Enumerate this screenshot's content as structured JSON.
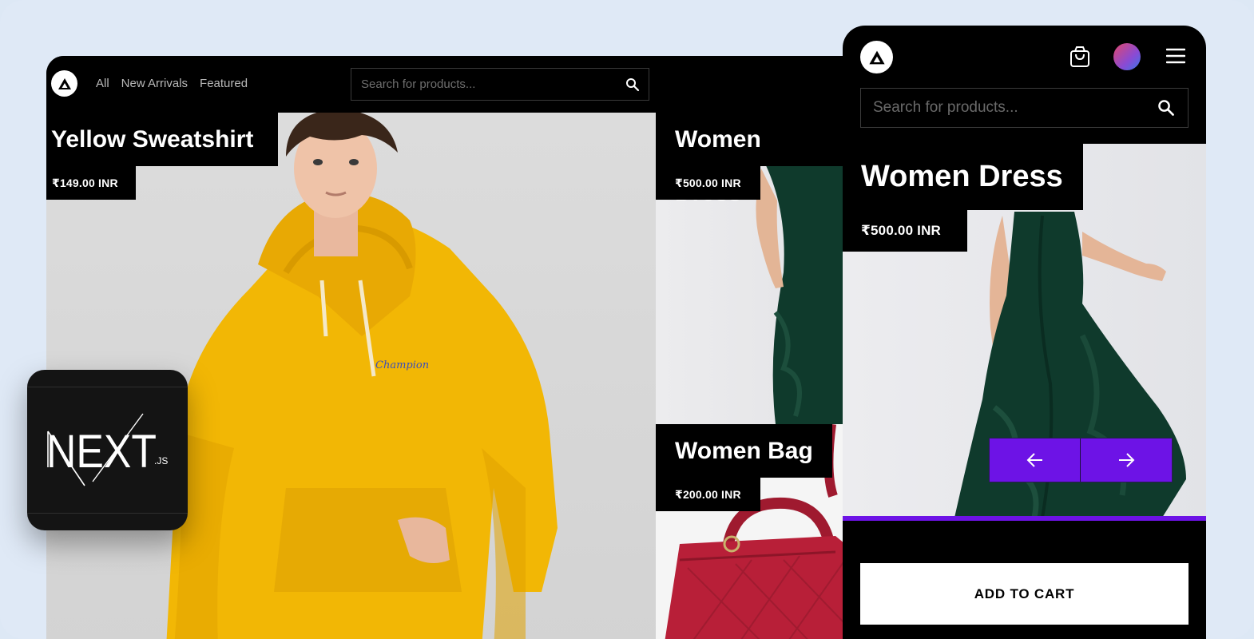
{
  "desktop": {
    "nav": {
      "links": [
        "All",
        "New Arrivals",
        "Featured"
      ]
    },
    "search": {
      "placeholder": "Search for products..."
    },
    "hero": {
      "title": "Yellow Sweatshirt",
      "price": "₹149.00 INR"
    },
    "tiles": [
      {
        "title": "Women Dress",
        "price": "₹500.00 INR"
      },
      {
        "title": "Women Bag",
        "price": "₹200.00 INR"
      }
    ]
  },
  "mobile": {
    "search": {
      "placeholder": "Search for products..."
    },
    "product": {
      "title": "Women Dress",
      "price": "₹500.00 INR"
    },
    "add_to_cart_label": "ADD TO CART",
    "icons": [
      "logo-icon",
      "shopping-bag-icon",
      "avatar",
      "hamburger-menu-icon",
      "search-icon",
      "arrow-left-icon",
      "arrow-right-icon"
    ]
  },
  "badge": {
    "brand": "NEXT",
    "suffix": ".JS"
  },
  "colors": {
    "accent": "#6d13e6",
    "background": "#dfe9f6",
    "header": "#000000",
    "sweatshirt": "#f2b705",
    "dress": "#0f3a2c",
    "bag": "#b81f38"
  }
}
